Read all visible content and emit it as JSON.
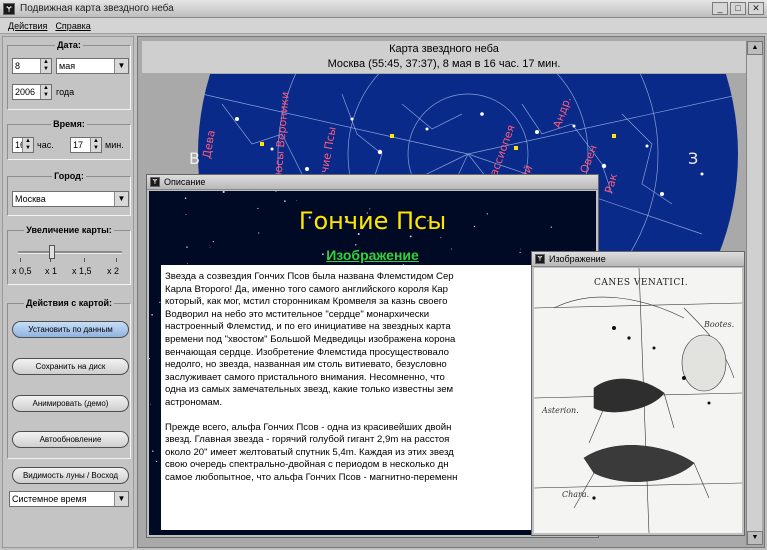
{
  "window": {
    "title": "Подвижная карта звездного неба",
    "icon": "app-icon"
  },
  "menu": {
    "items": [
      "Действия",
      "Справка"
    ]
  },
  "left": {
    "date_label": "Дата:",
    "day": "8",
    "month": "мая",
    "year": "2006",
    "year_suffix": "года",
    "time_label": "Время:",
    "hour": "16",
    "hour_suffix": "час.",
    "minute": "17",
    "minute_suffix": "мин.",
    "city_label": "Город:",
    "city": "Москва",
    "zoom_label": "Увеличение карты:",
    "zoom_value": 0.33,
    "zoom_ticks": [
      "x 0,5",
      "x 1",
      "x 1,5",
      "x 2"
    ],
    "actions_label": "Действия с картой:",
    "actions": [
      "Установить по данным",
      "Сохранить на диск",
      "Анимировать (демо)",
      "Автообновление"
    ],
    "moon_button": "Видимость луны / Восход",
    "time_mode": "Системное время"
  },
  "map": {
    "title": "Карта звездного неба",
    "subtitle": "Москва (55:45, 37:37), 8 мая в 16 час. 17 мин.",
    "compass_left": "В",
    "compass_right": "З",
    "constellations": [
      "Дева",
      "Волосы Вероники",
      "Гончие Псы",
      "Кассиопея",
      "Персей",
      "Рак",
      "Овен",
      "Андр."
    ]
  },
  "description": {
    "window_title": "Описание",
    "heading": "Гончие Псы",
    "link": "Изображение",
    "paragraphs": [
      [
        "Звезда а созвездия Гончих Псов была названа Флемстидом Сер",
        "Карла Второго! Да, именно того самого английского короля Кар",
        "который, как мог, мстил сторонникам Кромвеля за казнь своего",
        "Водворил на небо это мстительное \"сердце\" монархически",
        "настроенный Флемстид, и по его инициативе на звездных карта",
        "времени под \"хвостом\" Большой Медведицы изображена корона",
        "венчающая сердце. Изобретение Флемстида просуществовало",
        "недолго, но звезда, названная им столь витиевато, безусловно",
        "заслуживает самого пристального внимания. Несомненно, что",
        "одна из самых замечательных звезд, какие только известны зем",
        "астрономам."
      ],
      [
        "Прежде всего, альфа Гончих Псов - одна из красивейших двойн",
        "звезд. Главная звезда - горячий голубой гигант 2,9m на расстоя",
        "около 20\" имеет желтоватый спутник 5,4m. Каждая из этих звезд",
        "свою очередь спектрально-двойная с периодом в несколько дн",
        "самое любопытное, что альфа Гончих Псов - магнитно-переменн"
      ]
    ]
  },
  "image": {
    "window_title": "Изображение",
    "caption": "CANES VENATICI.",
    "labels": [
      "Bootes.",
      "Asterion.",
      "Chara."
    ]
  }
}
